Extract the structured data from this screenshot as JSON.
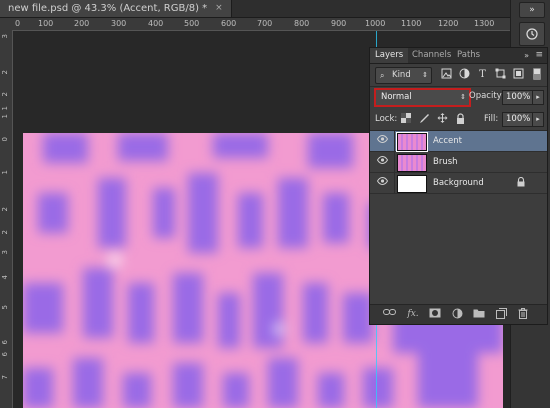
{
  "document": {
    "tab_title": "new file.psd @ 43.3% (Accent, RGB/8) *",
    "close_label": "×"
  },
  "rulers": {
    "top": [
      "0",
      "100",
      "200",
      "300",
      "400",
      "500",
      "600",
      "700",
      "800",
      "900",
      "1000",
      "1100",
      "1200",
      "1300"
    ],
    "left": [
      "3",
      "2",
      "2",
      "1",
      "1",
      "0",
      "1",
      "2",
      "2",
      "3",
      "4",
      "5",
      "6",
      "6",
      "7"
    ]
  },
  "right_strip": {
    "collapse_icon": "»",
    "history_icon": "history-icon"
  },
  "layers_panel": {
    "tabs": [
      {
        "label": "Layers",
        "active": true
      },
      {
        "label": "Channels",
        "active": false
      },
      {
        "label": "Paths",
        "active": false
      }
    ],
    "collapse_label": "»",
    "menu_label": "≡",
    "filter": {
      "kind_label": "Kind"
    },
    "blend_mode": "Normal",
    "opacity_label": "Opacity:",
    "opacity_value": "100%",
    "lock_label": "Lock:",
    "fill_label": "Fill:",
    "fill_value": "100%",
    "layers": [
      {
        "name": "Accent",
        "selected": true,
        "thumb": "pink",
        "locked": false
      },
      {
        "name": "Brush",
        "selected": false,
        "thumb": "pink",
        "locked": false
      },
      {
        "name": "Background",
        "selected": false,
        "thumb": "white",
        "locked": true
      }
    ],
    "footer_icons": [
      "link-icon",
      "fx-icon",
      "mask-icon",
      "adjustment-icon",
      "group-folder-icon",
      "new-layer-icon",
      "trash-icon"
    ]
  },
  "colors": {
    "canvas_pink": "#f29bd0",
    "canvas_purple": "#9a6be6",
    "selected_row": "#5f7490",
    "guide": "#2ad0ff",
    "highlight_border": "#c41e1e"
  }
}
